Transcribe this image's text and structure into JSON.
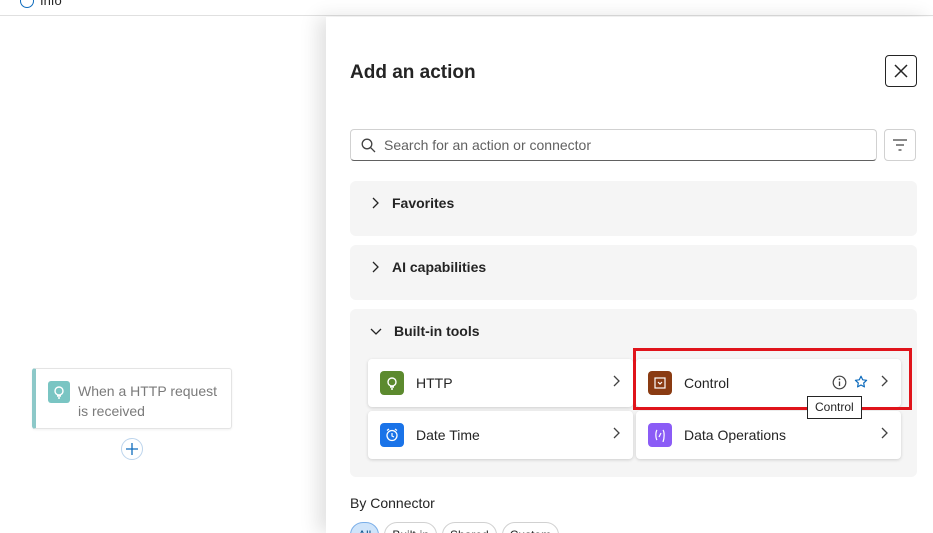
{
  "topbar": {
    "info_label": "Info"
  },
  "canvas": {
    "trigger_label": "When a HTTP request is received"
  },
  "panel": {
    "title": "Add an action",
    "search_placeholder": "Search for an action or connector",
    "sections": {
      "favorites": "Favorites",
      "ai": "AI capabilities",
      "builtin": "Built-in tools"
    },
    "tiles": {
      "http": {
        "label": "HTTP",
        "color": "#5c8a2e"
      },
      "control": {
        "label": "Control",
        "color": "#8a3b12"
      },
      "datetime": {
        "label": "Date Time",
        "color": "#1a73e8"
      },
      "dataops": {
        "label": "Data Operations",
        "color": "#8b5cf6"
      }
    },
    "tooltip": "Control",
    "by_connector": "By Connector",
    "filters": [
      "All",
      "Built-in",
      "Shared",
      "Custom"
    ]
  }
}
